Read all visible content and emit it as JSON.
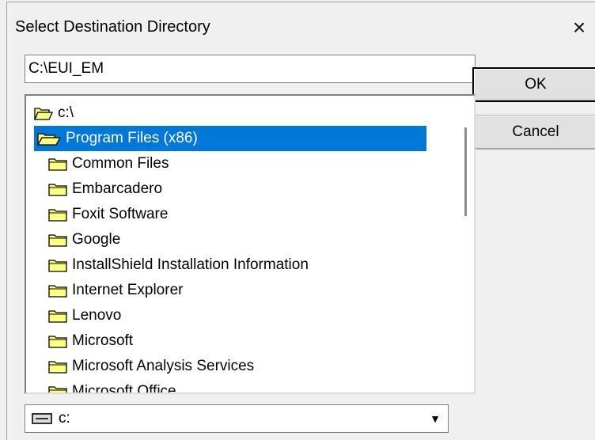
{
  "dialog": {
    "title": "Select Destination Directory",
    "close_glyph": "×"
  },
  "path_input": {
    "value": "C:\\EUI_EM"
  },
  "buttons": {
    "ok": "OK",
    "cancel": "Cancel"
  },
  "tree": {
    "root": {
      "label": "c:\\",
      "icon": "folder-open-icon"
    },
    "selected": {
      "label": "Program Files (x86)",
      "icon": "folder-open-icon"
    },
    "children": [
      {
        "label": "Common Files"
      },
      {
        "label": "Embarcadero"
      },
      {
        "label": "Foxit Software"
      },
      {
        "label": "Google"
      },
      {
        "label": "InstallShield Installation Information"
      },
      {
        "label": "Internet Explorer"
      },
      {
        "label": "Lenovo"
      },
      {
        "label": "Microsoft"
      },
      {
        "label": "Microsoft Analysis Services"
      },
      {
        "label": "Microsoft Office"
      }
    ]
  },
  "drive": {
    "label": "c:",
    "icon": "hard-drive-icon"
  },
  "colors": {
    "selection": "#0078d7",
    "folder": "#ffff80"
  }
}
